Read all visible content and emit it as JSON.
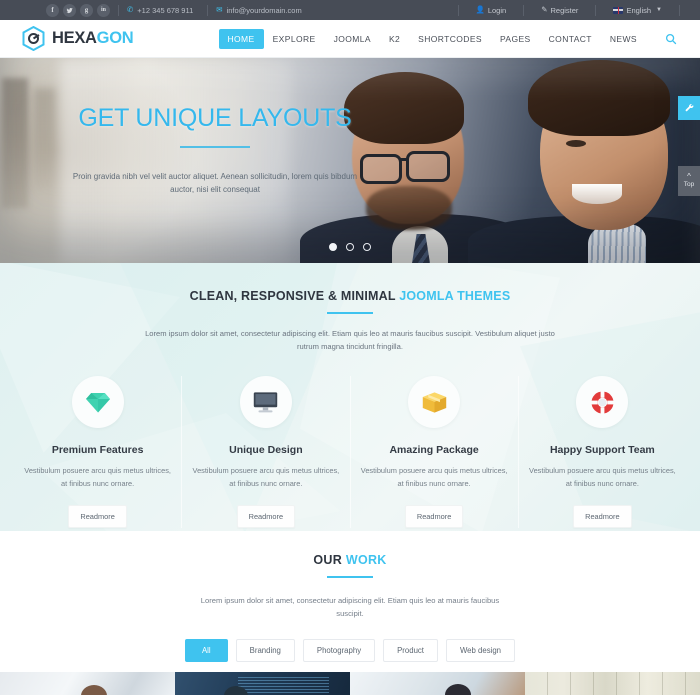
{
  "topbar": {
    "social": [
      {
        "name": "facebook-icon",
        "glyph": "f"
      },
      {
        "name": "twitter-icon",
        "glyph": "•"
      },
      {
        "name": "googleplus-icon",
        "glyph": "g"
      },
      {
        "name": "linkedin-icon",
        "glyph": "in"
      }
    ],
    "phone": "+12 345 678 911",
    "email": "info@yourdomain.com",
    "login": "Login",
    "register": "Register",
    "language": "English",
    "accent": "#3fc3ef",
    "background": "#474c56"
  },
  "header": {
    "logo_a": "HEXA",
    "logo_b": "GON",
    "nav": [
      {
        "label": "HOME",
        "active": true
      },
      {
        "label": "EXPLORE",
        "active": false
      },
      {
        "label": "JOOMLA",
        "active": false
      },
      {
        "label": "K2",
        "active": false
      },
      {
        "label": "SHORTCODES",
        "active": false
      },
      {
        "label": "PAGES",
        "active": false
      },
      {
        "label": "CONTACT",
        "active": false
      },
      {
        "label": "NEWS",
        "active": false
      }
    ]
  },
  "hero": {
    "title": "GET UNIQUE LAYOUTS",
    "text": "Proin gravida nibh vel velit auctor aliquet. Aenean sollicitudin, lorem quis bibdum auctor, nisi elit consequat",
    "slides": 3,
    "active_slide": 1,
    "title_color": "#35b8ed"
  },
  "side": {
    "wrench_label": "ὒ7",
    "top_label": "Top"
  },
  "features": {
    "title_dark": "CLEAN, RESPONSIVE & MINIMAL",
    "title_blue": "JOOMLA THEMES",
    "subtitle": "Lorem ipsum dolor sit amet, consectetur adipiscing elit. Etiam quis leo at mauris faucibus suscipit. Vestibulum aliquet justo rutrum magna tincidunt fringilla.",
    "cards": [
      {
        "icon": "diamond-icon",
        "title": "Premium Features",
        "text": "Vestibulum posuere arcu quis metus ultrices, at finibus nunc ornare.",
        "button": "Readmore",
        "color": "#3fd2b0"
      },
      {
        "icon": "monitor-icon",
        "title": "Unique Design",
        "text": "Vestibulum posuere arcu quis metus ultrices, at finibus nunc ornare.",
        "button": "Readmore",
        "color": "#3a4451"
      },
      {
        "icon": "package-box-icon",
        "title": "Amazing Package",
        "text": "Vestibulum posuere arcu quis metus ultrices, at finibus nunc ornare.",
        "button": "Readmore",
        "color": "#f6c744"
      },
      {
        "icon": "lifebuoy-icon",
        "title": "Happy Support Team",
        "text": "Vestibulum posuere arcu quis metus ultrices, at finibus nunc ornare.",
        "button": "Readmore",
        "color": "#e23b3b"
      }
    ]
  },
  "work": {
    "title_dark": "OUR",
    "title_blue": "WORK",
    "subtitle": "Lorem ipsum dolor sit amet, consectetur adipiscing elit. Etiam quis leo at mauris faucibus suscipit.",
    "filters": [
      {
        "label": "All",
        "active": true
      },
      {
        "label": "Branding",
        "active": false
      },
      {
        "label": "Photography",
        "active": false
      },
      {
        "label": "Product",
        "active": false
      },
      {
        "label": "Web design",
        "active": false
      }
    ]
  }
}
